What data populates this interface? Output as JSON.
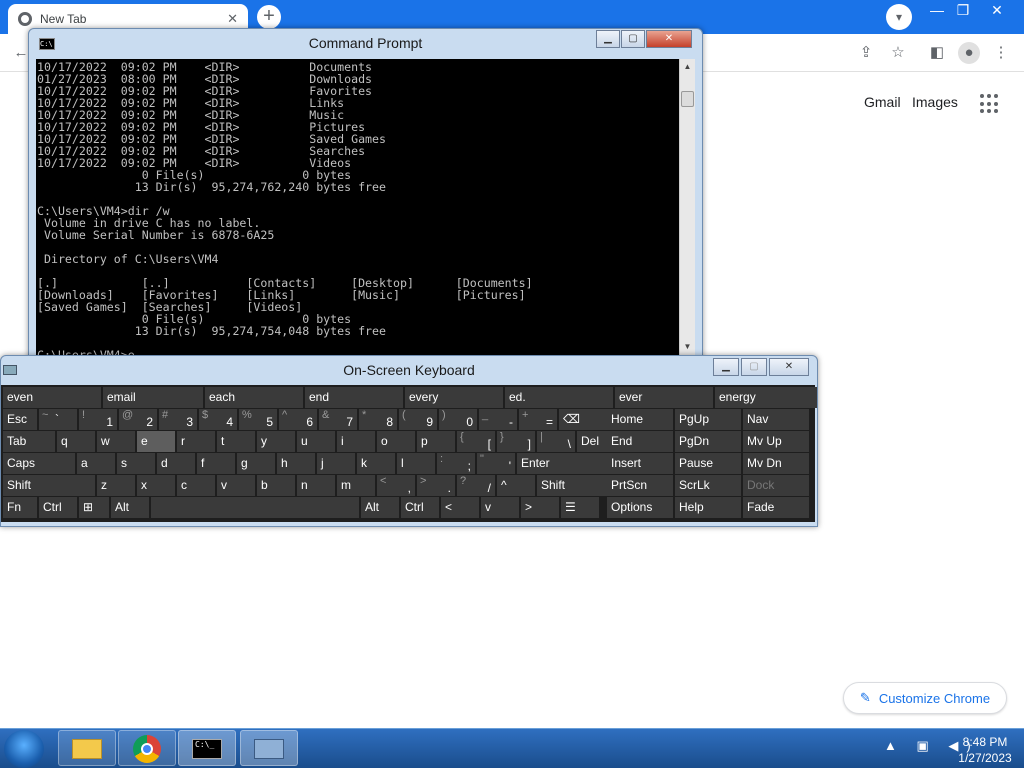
{
  "chrome": {
    "tab_title": "New Tab",
    "new_tab": "+",
    "gmail": "Gmail",
    "images": "Images",
    "customize": "Customize Chrome"
  },
  "cmd": {
    "title": "Command Prompt",
    "lines": [
      "10/17/2022  09:02 PM    <DIR>          Documents",
      "01/27/2023  08:00 PM    <DIR>          Downloads",
      "10/17/2022  09:02 PM    <DIR>          Favorites",
      "10/17/2022  09:02 PM    <DIR>          Links",
      "10/17/2022  09:02 PM    <DIR>          Music",
      "10/17/2022  09:02 PM    <DIR>          Pictures",
      "10/17/2022  09:02 PM    <DIR>          Saved Games",
      "10/17/2022  09:02 PM    <DIR>          Searches",
      "10/17/2022  09:02 PM    <DIR>          Videos",
      "               0 File(s)              0 bytes",
      "              13 Dir(s)  95,274,762,240 bytes free",
      "",
      "C:\\Users\\VM4>dir /w",
      " Volume in drive C has no label.",
      " Volume Serial Number is 6878-6A25",
      "",
      " Directory of C:\\Users\\VM4",
      "",
      "[.]            [..]           [Contacts]     [Desktop]      [Documents]",
      "[Downloads]    [Favorites]    [Links]        [Music]        [Pictures]",
      "[Saved Games]  [Searches]     [Videos]",
      "               0 File(s)              0 bytes",
      "              13 Dir(s)  95,274,754,048 bytes free",
      "",
      "C:\\Users\\VM4>e"
    ]
  },
  "osk": {
    "title": "On-Screen Keyboard",
    "predictions": [
      "even",
      "email",
      "each",
      "end",
      "every",
      "ed.",
      "ever",
      "energy"
    ],
    "rows": [
      [
        {
          "m": "Esc",
          "w": 34
        },
        {
          "s": "~",
          "m": "`",
          "w": 38
        },
        {
          "s": "!",
          "c": "1",
          "w": 38
        },
        {
          "s": "@",
          "c": "2",
          "w": 38
        },
        {
          "s": "#",
          "c": "3",
          "w": 38
        },
        {
          "s": "$",
          "c": "4",
          "w": 38
        },
        {
          "s": "%",
          "c": "5",
          "w": 38
        },
        {
          "s": "^",
          "c": "6",
          "w": 38
        },
        {
          "s": "&",
          "c": "7",
          "w": 38
        },
        {
          "s": "*",
          "c": "8",
          "w": 38
        },
        {
          "s": "(",
          "c": "9",
          "w": 38
        },
        {
          "s": ")",
          "c": "0",
          "w": 38
        },
        {
          "s": "_",
          "c": "-",
          "w": 38
        },
        {
          "s": "+",
          "c": "=",
          "w": 38
        },
        {
          "m": "⌫",
          "w": 64
        }
      ],
      [
        {
          "m": "Tab",
          "w": 52
        },
        {
          "m": "q",
          "w": 38
        },
        {
          "m": "w",
          "w": 38
        },
        {
          "m": "e",
          "w": 38,
          "sel": true
        },
        {
          "m": "r",
          "w": 38
        },
        {
          "m": "t",
          "w": 38
        },
        {
          "m": "y",
          "w": 38
        },
        {
          "m": "u",
          "w": 38
        },
        {
          "m": "i",
          "w": 38
        },
        {
          "m": "o",
          "w": 38
        },
        {
          "m": "p",
          "w": 38
        },
        {
          "s": "{",
          "c": "[",
          "w": 38
        },
        {
          "s": "}",
          "c": "]",
          "w": 38
        },
        {
          "s": "|",
          "c": "\\",
          "w": 38
        },
        {
          "m": "Del",
          "w": 46
        }
      ],
      [
        {
          "m": "Caps",
          "w": 72
        },
        {
          "m": "a",
          "w": 38
        },
        {
          "m": "s",
          "w": 38
        },
        {
          "m": "d",
          "w": 38
        },
        {
          "m": "f",
          "w": 38
        },
        {
          "m": "g",
          "w": 38
        },
        {
          "m": "h",
          "w": 38
        },
        {
          "m": "j",
          "w": 38
        },
        {
          "m": "k",
          "w": 38
        },
        {
          "m": "l",
          "w": 38
        },
        {
          "s": ":",
          "c": ";",
          "w": 38
        },
        {
          "s": "\"",
          "c": "'",
          "w": 38
        },
        {
          "m": "Enter",
          "w": 104
        }
      ],
      [
        {
          "m": "Shift",
          "w": 92
        },
        {
          "m": "z",
          "w": 38
        },
        {
          "m": "x",
          "w": 38
        },
        {
          "m": "c",
          "w": 38
        },
        {
          "m": "v",
          "w": 38
        },
        {
          "m": "b",
          "w": 38
        },
        {
          "m": "n",
          "w": 38
        },
        {
          "m": "m",
          "w": 38
        },
        {
          "s": "<",
          "c": ",",
          "w": 38
        },
        {
          "s": ">",
          "c": ".",
          "w": 38
        },
        {
          "s": "?",
          "c": "/",
          "w": 38
        },
        {
          "m": "^",
          "w": 38
        },
        {
          "m": "Shift",
          "w": 84
        }
      ],
      [
        {
          "m": "Fn",
          "w": 34
        },
        {
          "m": "Ctrl",
          "w": 38
        },
        {
          "m": "⊞",
          "w": 30
        },
        {
          "m": "Alt",
          "w": 38
        },
        {
          "m": "",
          "w": 208
        },
        {
          "m": "Alt",
          "w": 38
        },
        {
          "m": "Ctrl",
          "w": 38
        },
        {
          "m": "<",
          "w": 38
        },
        {
          "m": "v",
          "w": 38
        },
        {
          "m": ">",
          "w": 38
        },
        {
          "m": "☰",
          "w": 38
        }
      ]
    ],
    "side_rows": [
      [
        {
          "m": "Home"
        },
        {
          "m": "PgUp"
        },
        {
          "m": "Nav"
        }
      ],
      [
        {
          "m": "End"
        },
        {
          "m": "PgDn"
        },
        {
          "m": "Mv Up"
        }
      ],
      [
        {
          "m": "Insert"
        },
        {
          "m": "Pause"
        },
        {
          "m": "Mv Dn"
        }
      ],
      [
        {
          "m": "PrtScn"
        },
        {
          "m": "ScrLk"
        },
        {
          "m": "Dock",
          "dim": true
        }
      ],
      [
        {
          "m": "Options"
        },
        {
          "m": "Help"
        },
        {
          "m": "Fade"
        }
      ]
    ]
  },
  "taskbar": {
    "time": "8:48 PM",
    "date": "1/27/2023"
  }
}
